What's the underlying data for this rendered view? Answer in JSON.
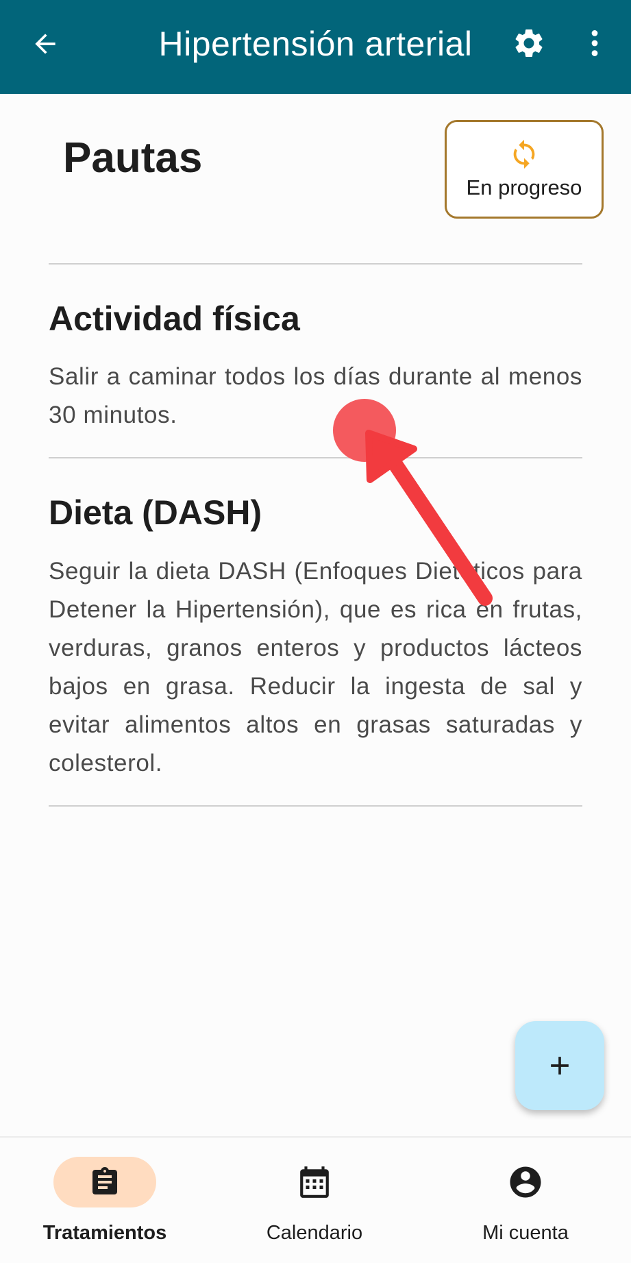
{
  "appbar": {
    "title": "Hipertensión arterial",
    "back_icon": "arrow-left-icon",
    "settings_icon": "gear-icon",
    "more_icon": "more-vertical-icon",
    "background_color": "#02657a"
  },
  "header": {
    "title": "Pautas",
    "status": {
      "label": "En progreso",
      "icon": "sync-icon",
      "icon_color": "#f5a623",
      "border_color": "#a4782c"
    }
  },
  "sections": [
    {
      "title": "Actividad física",
      "text": "Salir a caminar todos los días durante al menos 30 minutos."
    },
    {
      "title": "Dieta (DASH)",
      "text": "Seguir la dieta DASH (Enfoques Dietéticos para Detener la Hipertensión), que es rica en frutas, verduras, granos enteros y productos lácteos bajos en grasa. Reducir la ingesta de sal y evitar alimentos altos en grasas saturadas y colesterol."
    }
  ],
  "fab": {
    "icon": "plus-icon",
    "color": "#bde9fb"
  },
  "bottom_nav": {
    "items": [
      {
        "label": "Tratamientos",
        "icon": "clipboard-icon",
        "active": true
      },
      {
        "label": "Calendario",
        "icon": "calendar-icon",
        "active": false
      },
      {
        "label": "Mi cuenta",
        "icon": "account-circle-icon",
        "active": false
      }
    ],
    "active_color": "#ffdcc0"
  },
  "annotation": {
    "color": "#f23b3f"
  }
}
